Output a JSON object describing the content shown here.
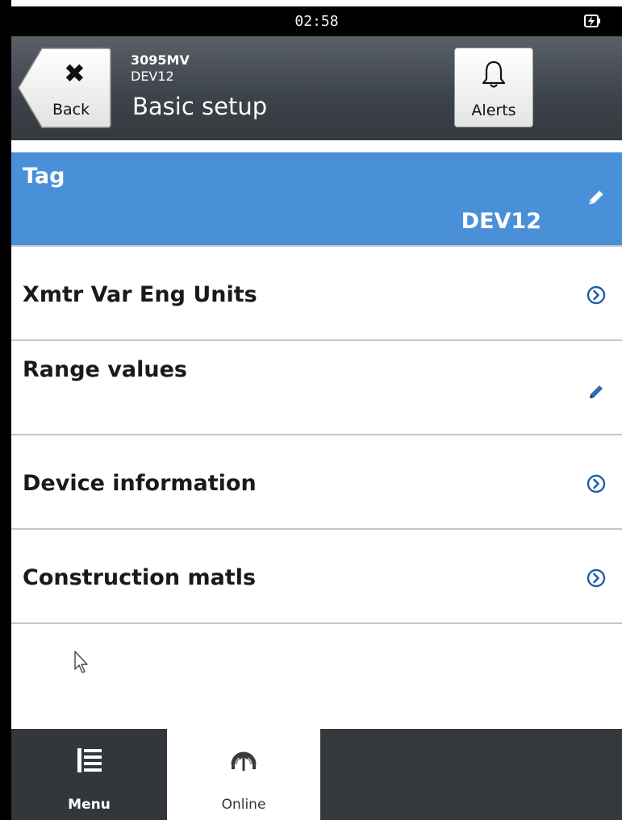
{
  "status_bar": {
    "time": "02:58",
    "battery_icon": "battery-charging-icon"
  },
  "header": {
    "back_label": "Back",
    "back_glyph": "✖",
    "device_model": "3095MV",
    "device_tag": "DEV12",
    "title": "Basic setup",
    "alerts_label": "Alerts"
  },
  "list": {
    "tag": {
      "label": "Tag",
      "value": "DEV12",
      "icon": "pencil-icon"
    },
    "items": [
      {
        "label": "Xmtr Var Eng Units",
        "icon": "chevron-circle-right-icon"
      },
      {
        "label": "Range values",
        "icon": "pencil-icon"
      },
      {
        "label": "Device information",
        "icon": "chevron-circle-right-icon"
      },
      {
        "label": "Construction matls",
        "icon": "chevron-circle-right-icon"
      }
    ]
  },
  "tabs": [
    {
      "label": "Menu",
      "icon": "menu-list-icon",
      "selected": false
    },
    {
      "label": "Online",
      "icon": "online-gauge-icon",
      "selected": true
    }
  ],
  "colors": {
    "accent": "#4a90d9",
    "titlebar": "#3c4249",
    "tabbar": "#34383c",
    "icon_blue": "#1f5fa8"
  }
}
